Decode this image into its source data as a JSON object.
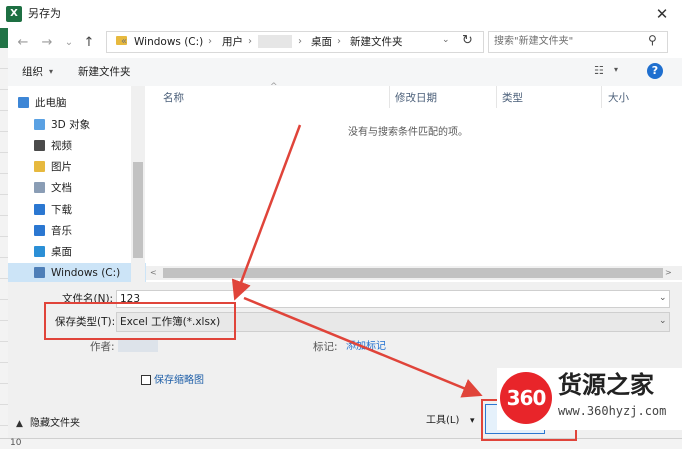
{
  "window": {
    "title": "另存为",
    "app_icon_letter": "X",
    "close_glyph": "✕"
  },
  "nav_buttons": {
    "back": "←",
    "forward": "→",
    "dropdown": "⌄",
    "up": "↑"
  },
  "address": {
    "prefix": "«",
    "crumbs": [
      "Windows (C:)",
      "用户",
      "桌面",
      "新建文件夹"
    ],
    "separator": "›",
    "dropdown": "⌄",
    "refresh": "↻"
  },
  "search": {
    "placeholder": "搜索\"新建文件夹\"",
    "icon": "⚲"
  },
  "toolbar": {
    "organize": "组织",
    "organize_caret": "▾",
    "new_folder": "新建文件夹",
    "view_icon": "☷",
    "view_caret": "▾",
    "help": "?"
  },
  "sidebar": {
    "items": [
      {
        "label": "此电脑",
        "icon": "pc-icon",
        "color": "#3d86d6"
      },
      {
        "label": "3D 对象",
        "icon": "cube-icon",
        "color": "#5aa1e3"
      },
      {
        "label": "视频",
        "icon": "video-icon",
        "color": "#4a4a4a"
      },
      {
        "label": "图片",
        "icon": "pictures-icon",
        "color": "#e7b93e"
      },
      {
        "label": "文档",
        "icon": "documents-icon",
        "color": "#8a9db5"
      },
      {
        "label": "下载",
        "icon": "download-icon",
        "color": "#2b77d1"
      },
      {
        "label": "音乐",
        "icon": "music-icon",
        "color": "#2b77d1"
      },
      {
        "label": "桌面",
        "icon": "desktop-icon",
        "color": "#2b8fd6"
      },
      {
        "label": "Windows (C:)",
        "icon": "drive-icon",
        "color": "#4e7fb8"
      }
    ]
  },
  "file_list": {
    "columns": [
      "名称",
      "修改日期",
      "类型",
      "大小"
    ],
    "sort_indicator": "^",
    "empty_message": "没有与搜索条件匹配的项。",
    "scroll_left": "<",
    "scroll_right": ">"
  },
  "form": {
    "filename_label": "文件名(N):",
    "filename_value": "123",
    "filetype_label": "保存类型(T):",
    "filetype_value": "Excel 工作簿(*.xlsx)",
    "caret": "⌄",
    "author_label": "作者:",
    "tags_label": "标记:",
    "tags_value": "添加标记",
    "save_thumbnail": "保存缩略图",
    "hide_folders_caret": "▲",
    "hide_folders": "隐藏文件夹",
    "tools": "工具(L)",
    "tools_caret": "▾"
  },
  "excel_background": {
    "row_number": "10"
  },
  "watermark": {
    "badge": "360",
    "name": "货源之家",
    "url": "www.360hyzj.com"
  },
  "annotation_color": "#e0443a"
}
